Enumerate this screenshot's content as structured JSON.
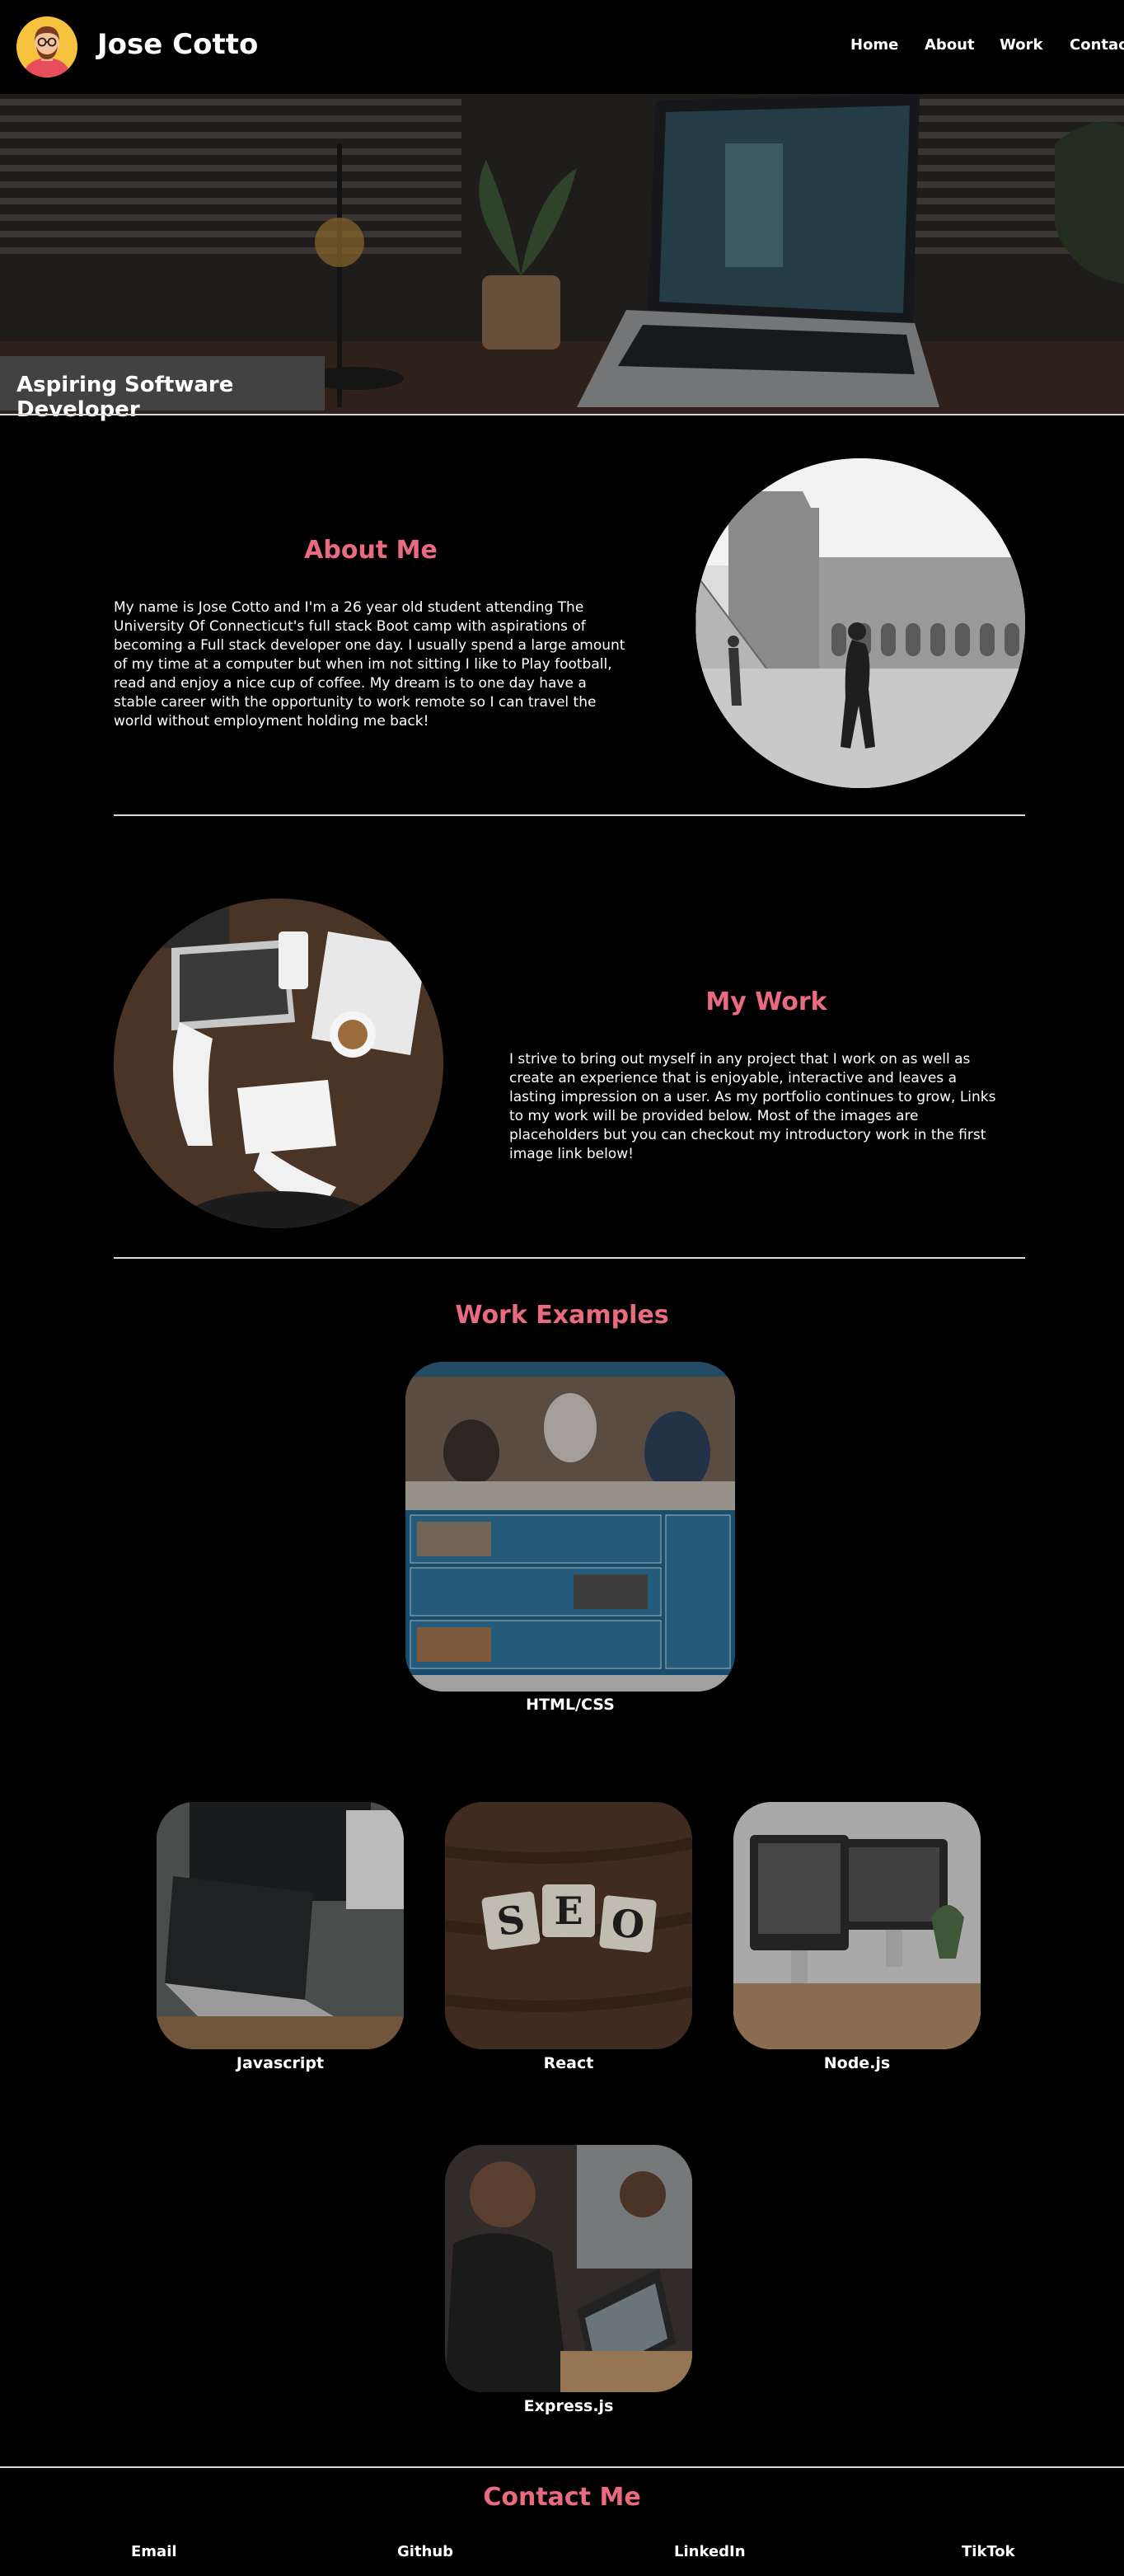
{
  "header": {
    "name": "Jose Cotto",
    "nav": [
      "Home",
      "About",
      "Work",
      "Contact"
    ]
  },
  "hero": {
    "caption": "Aspiring Software Developer"
  },
  "about": {
    "title": "About Me",
    "text": "My name is Jose Cotto and I'm a 26 year old student attending The University Of Connecticut's full stack Boot camp with aspirations of becoming a Full stack developer one day. I usually spend a large amount of my time at a computer but when im not sitting I like to Play football, read and enjoy a nice cup of coffee. My dream is to one day have a stable career with the opportunity to work remote so I can travel the world without employment holding me back!"
  },
  "work": {
    "title": "My Work",
    "text": "I strive to bring out myself in any project that I work on as well as create an experience that is enjoyable, interactive and leaves a lasting impression on a user. As my portfolio continues to grow, Links to my work will be provided below. Most of the images are placeholders but you can checkout my introductory work in the first image link below!"
  },
  "examples": {
    "title": "Work Examples",
    "items": [
      "HTML/CSS",
      "Javascript",
      "React",
      "Node.js",
      "Express.js"
    ],
    "seo_tiles": [
      "S",
      "E",
      "O"
    ]
  },
  "contact": {
    "title": "Contact Me",
    "links": [
      "Email",
      "Github",
      "LinkedIn",
      "TikTok"
    ]
  },
  "colors": {
    "accent": "#ea6b80",
    "background": "#000000",
    "caption_bg": "#424242"
  }
}
